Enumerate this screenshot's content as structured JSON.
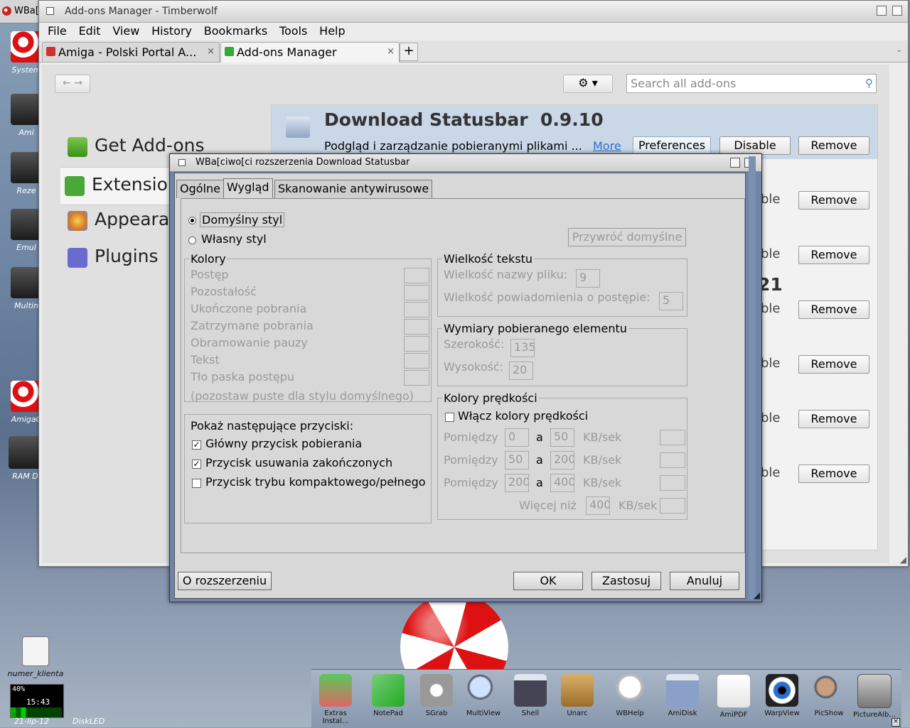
{
  "desktop": {
    "screen_title": "WBa[",
    "icons": [
      {
        "label": "System"
      },
      {
        "label": "Ami"
      },
      {
        "label": "Reze"
      },
      {
        "label": "Emul"
      },
      {
        "label": "Multin"
      },
      {
        "label": "AmigaC"
      },
      {
        "label": "RAM Di"
      },
      {
        "label": "numer_klienta"
      }
    ],
    "diskled": {
      "percent": "40%",
      "time": "15:43",
      "date": "21-lip-12",
      "label": "DiskLED"
    }
  },
  "browser": {
    "title": "Add-ons Manager - Timberwolf",
    "menu": [
      "File",
      "Edit",
      "View",
      "History",
      "Bookmarks",
      "Tools",
      "Help"
    ],
    "tabs": [
      {
        "label": "Amiga - Polski Portal A...",
        "active": false
      },
      {
        "label": "Add-ons Manager",
        "active": true
      }
    ],
    "new_tab": "+",
    "nav": {
      "back": "←",
      "forward": "→"
    },
    "gear": "⚙ ▾",
    "search_placeholder": "Search all add-ons",
    "categories": [
      {
        "label": "Get Add-ons",
        "selected": false
      },
      {
        "label": "Extensions",
        "selected": true
      },
      {
        "label": "Appearance",
        "selected": false
      },
      {
        "label": "Plugins",
        "selected": false
      }
    ],
    "selected_extension": {
      "name": "Download Statusbar",
      "version": "0.9.10",
      "description": "Podgląd i zarządzanie pobieranymi plikami ...",
      "more": "More",
      "preferences": "Preferences",
      "disable": "Disable",
      "remove": "Remove"
    },
    "other_rows": [
      {
        "partial": "ble",
        "remove": "Remove"
      },
      {
        "partial": "ble",
        "remove": "Remove"
      },
      {
        "partial": "ble",
        "remove": "Remove",
        "fragment": "21"
      },
      {
        "partial": "ble",
        "remove": "Remove"
      },
      {
        "partial": "ble",
        "remove": "Remove"
      },
      {
        "partial": "ble",
        "remove": "Remove"
      }
    ]
  },
  "dialog": {
    "title": "WBa[ciwo[ci rozszerzenia Download Statusbar",
    "tabs": [
      "Ogólne",
      "Wygląd",
      "Skanowanie antywirusowe"
    ],
    "style": {
      "default": "Domyślny styl",
      "custom": "Własny styl",
      "selected": "default"
    },
    "restore_defaults": "Przywróć domyślne",
    "colors": {
      "title": "Kolory",
      "items": [
        "Postęp",
        "Pozostałość",
        "Ukończone pobrania",
        "Zatrzymane pobrania",
        "Obramowanie pauzy",
        "Tekst",
        "Tło paska postępu"
      ],
      "hint": "(pozostaw puste dla stylu domyślnego)"
    },
    "text_size": {
      "title": "Wielkość tekstu",
      "filename_label": "Wielkość nazwy pliku:",
      "filename_value": "9",
      "progress_label": "Wielkość powiadomienia o postępie:",
      "progress_value": "5"
    },
    "dimensions": {
      "title": "Wymiary pobieranego elementu",
      "width_label": "Szerokość:",
      "width_value": "135",
      "height_label": "Wysokość:",
      "height_value": "20"
    },
    "buttons_group": {
      "title": "Pokaż następujące przyciski:",
      "items": [
        {
          "label": "Główny przycisk pobierania",
          "checked": true
        },
        {
          "label": "Przycisk usuwania zakończonych",
          "checked": true
        },
        {
          "label": "Przycisk trybu kompaktowego/pełnego",
          "checked": false
        }
      ]
    },
    "speed_colors": {
      "title": "Kolory prędkości",
      "enable_label": "Włącz kolory prędkości",
      "between": "Pomiędzy",
      "and": "a",
      "unit": "KB/sek",
      "more_than": "Więcej niż",
      "rows": [
        {
          "from": "0",
          "to": "50"
        },
        {
          "from": "50",
          "to": "200"
        },
        {
          "from": "200",
          "to": "400"
        }
      ],
      "more_value": "400"
    },
    "footer": {
      "about": "O rozszerzeniu",
      "ok": "OK",
      "apply": "Zastosuj",
      "cancel": "Anuluj"
    }
  },
  "dock": [
    {
      "label": "Extras Instal..."
    },
    {
      "label": "NotePad"
    },
    {
      "label": "SGrab"
    },
    {
      "label": "MultiView"
    },
    {
      "label": "Shell"
    },
    {
      "label": "Unarc"
    },
    {
      "label": "WBHelp"
    },
    {
      "label": "AmiDisk"
    },
    {
      "label": "AmiPDF"
    },
    {
      "label": "WarpView"
    },
    {
      "label": "PicShow"
    },
    {
      "label": "PictureAlb..."
    }
  ]
}
